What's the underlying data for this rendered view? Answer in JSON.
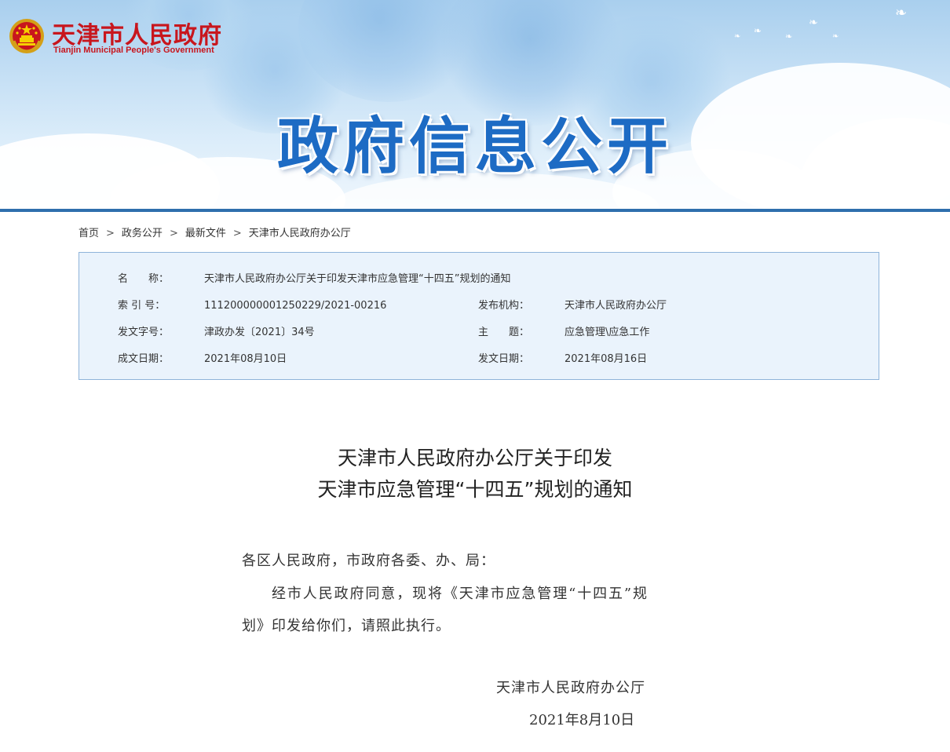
{
  "site": {
    "logo_title": "天津市人民政府",
    "logo_subtitle": "Tianjin Municipal People's Government",
    "banner_title": "政府信息公开"
  },
  "breadcrumb": {
    "items": [
      "首页",
      "政务公开",
      "最新文件",
      "天津市人民政府办公厅"
    ],
    "separator": ">"
  },
  "info": {
    "name_label": "名　　称：",
    "name_value": "天津市人民政府办公厅关于印发天津市应急管理“十四五”规划的通知",
    "index_label": "索 引 号：",
    "index_value": "111200000001250229/2021-00216",
    "publisher_label": "发布机构：",
    "publisher_value": "天津市人民政府办公厅",
    "doc_no_label": "发文字号：",
    "doc_no_value": "津政办发〔2021〕34号",
    "topic_label": "主　　题：",
    "topic_value": "应急管理\\应急工作",
    "created_label": "成文日期：",
    "created_value": "2021年08月10日",
    "issued_label": "发文日期：",
    "issued_value": "2021年08月16日"
  },
  "article": {
    "title_line1": "天津市人民政府办公厅关于印发",
    "title_line2": "天津市应急管理“十四五”规划的通知",
    "salutation": "各区人民政府，市政府各委、办、局：",
    "para1_line1": "经市人民政府同意，现将《天津市应急管理“十四五”规",
    "para1_line2": "划》印发给你们，请照此执行。",
    "signature": "天津市人民政府办公厅",
    "date": "2021年8月10日"
  },
  "colors": {
    "brand_red": "#c8161d",
    "banner_blue": "#1d6bc4",
    "info_bg": "#eaf3fc",
    "info_border": "#8fb4d9"
  }
}
